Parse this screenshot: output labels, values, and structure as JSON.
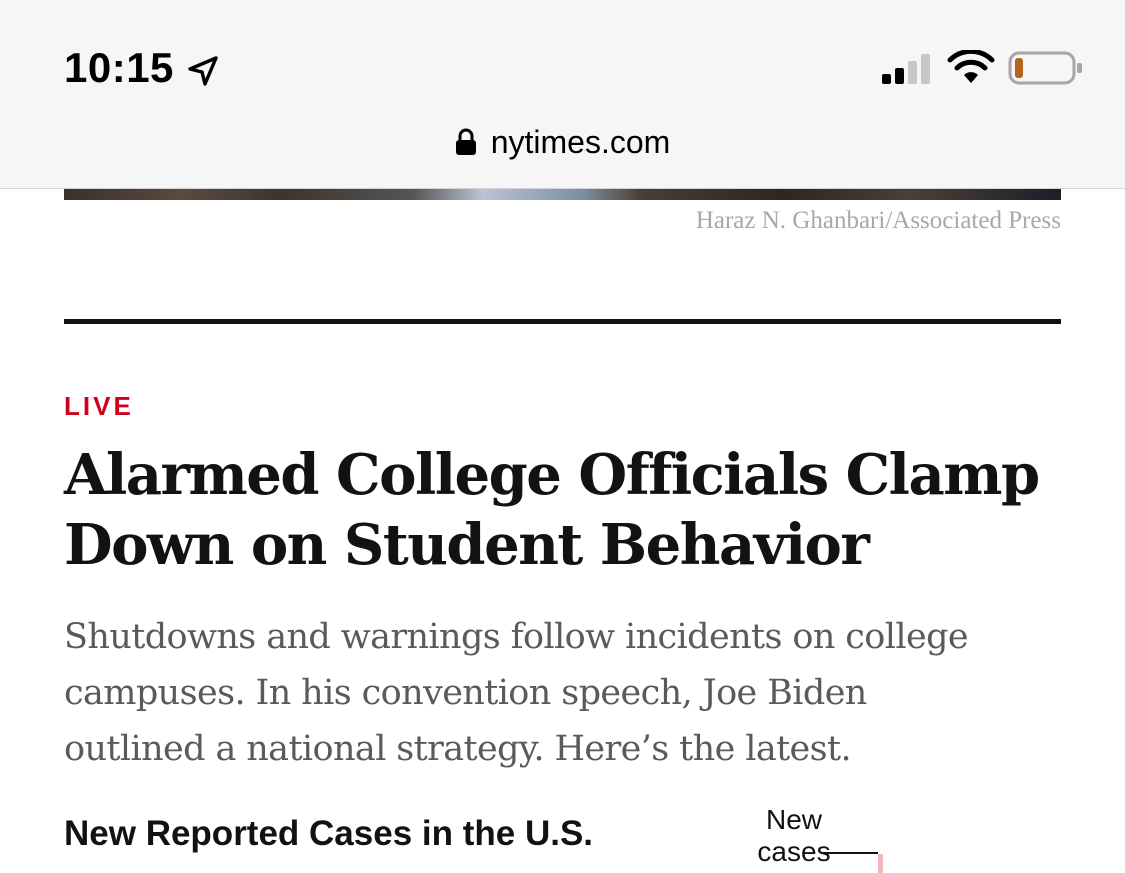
{
  "status_bar": {
    "time": "10:15",
    "icons": [
      "location-arrow-icon",
      "cellular-signal-icon",
      "wifi-icon",
      "battery-icon"
    ],
    "battery_level": 0.15,
    "battery_color": "#b5651d"
  },
  "browser": {
    "url": "nytimes.com",
    "lock_icon": "lock-icon"
  },
  "photo": {
    "credit": "Haraz N. Ghanbari/Associated Press"
  },
  "article": {
    "kicker": "LIVE",
    "kicker_color": "#d0021b",
    "headline_line1": "Alarmed College Officials Clamp",
    "headline_line2": "Down on Student Behavior",
    "summary_line1": "Shutdowns and warnings follow incidents on college",
    "summary_line2": "campuses. In his convention speech, Joe Biden",
    "summary_line3": "outlined a national strategy. Here’s the latest."
  },
  "chart": {
    "title": "New Reported Cases in the U.S.",
    "label_line1": "New",
    "label_line2": "cases",
    "bar_color": "#f3b6bd"
  }
}
